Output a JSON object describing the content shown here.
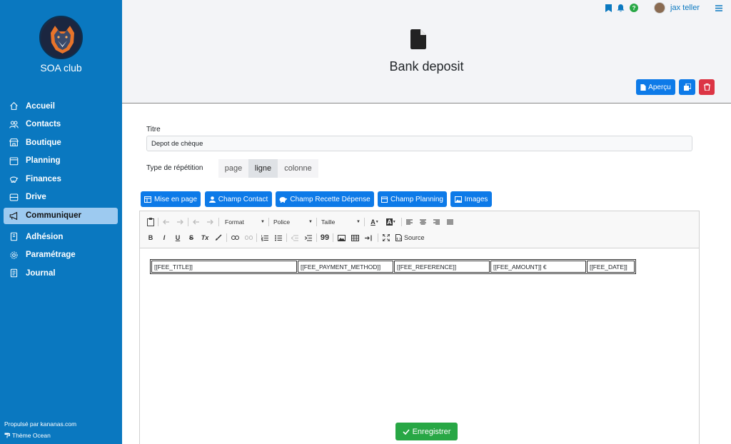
{
  "app": {
    "club_name": "SOA club",
    "footer_powered": "Propulsé par kananas.com",
    "footer_theme": "Thème Ocean"
  },
  "sidebar": {
    "items": [
      {
        "label": "Accueil",
        "icon": "home-icon"
      },
      {
        "label": "Contacts",
        "icon": "users-icon"
      },
      {
        "label": "Boutique",
        "icon": "shop-icon"
      },
      {
        "label": "Planning",
        "icon": "calendar-icon"
      },
      {
        "label": "Finances",
        "icon": "piggy-bank-icon"
      },
      {
        "label": "Drive",
        "icon": "drive-icon"
      },
      {
        "label": "Communiquer",
        "icon": "megaphone-icon",
        "active": true
      },
      {
        "label": "Adhésion",
        "icon": "id-card-icon"
      },
      {
        "label": "Paramétrage",
        "icon": "gear-icon"
      },
      {
        "label": "Journal",
        "icon": "journal-icon"
      }
    ]
  },
  "topbar": {
    "user_name": "jax teller",
    "help_label": "?"
  },
  "header": {
    "title": "Bank deposit",
    "preview_label": "Aperçu"
  },
  "form": {
    "title_label": "Titre",
    "title_value": "Depot de chèque",
    "repeat_label": "Type de répétition",
    "repeat_options": [
      "page",
      "ligne",
      "colonne"
    ],
    "repeat_selected": "ligne"
  },
  "field_buttons": [
    "Mise en page",
    "Champ Contact",
    "Champ Recette Dépense",
    "Champ Planning",
    "Images"
  ],
  "editor": {
    "format_label": "Format",
    "font_label": "Police",
    "size_label": "Taille",
    "source_label": "Source",
    "bold": "B",
    "italic": "I",
    "underline": "U",
    "strike": "S",
    "remove_format": "Tx",
    "quote": "99",
    "text_color": "A",
    "bg_color": "A",
    "table_cells": [
      "[[FEE_TITLE]]",
      "[[FEE_PAYMENT_METHOD]]",
      "[[FEE_REFERENCE]]",
      "[[FEE_AMOUNT]] €",
      "[[FEE_DATE]]"
    ]
  },
  "save_label": "Enregistrer",
  "colors": {
    "sidebar": "#0a78c0",
    "primary": "#0d7ae8",
    "danger": "#dc3545",
    "success": "#28a745",
    "header_bg": "#f3f4f7"
  }
}
